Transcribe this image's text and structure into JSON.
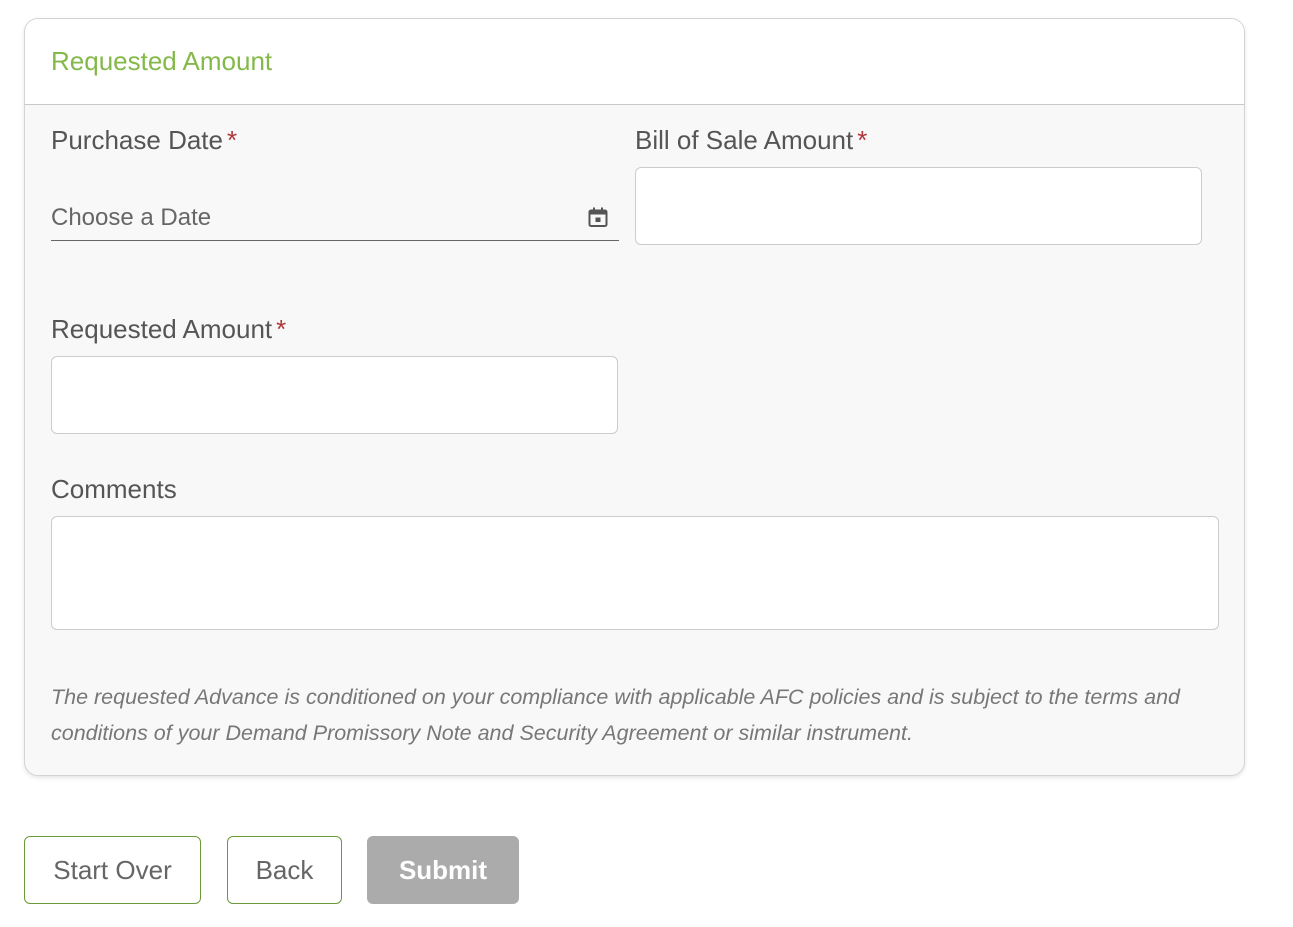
{
  "card": {
    "title": "Requested Amount"
  },
  "form": {
    "required_marker": "*",
    "purchase_date": {
      "label": "Purchase Date",
      "placeholder": "Choose a Date"
    },
    "bill_of_sale_amount": {
      "label": "Bill of Sale Amount",
      "value": ""
    },
    "requested_amount": {
      "label": "Requested Amount",
      "value": ""
    },
    "comments": {
      "label": "Comments",
      "value": ""
    },
    "disclaimer": "The requested Advance is conditioned on your compliance with applicable AFC policies and is subject to the terms and conditions of your Demand Promissory Note and Security Agreement or similar instrument."
  },
  "actions": {
    "start_over_label": "Start Over",
    "back_label": "Back",
    "submit_label": "Submit"
  },
  "icons": {
    "calendar": "calendar-icon"
  },
  "colors": {
    "accent_green": "#84b94a",
    "button_border_green": "#6a9a3a",
    "required_red": "#b0353a",
    "disabled_gray": "#ababab"
  }
}
